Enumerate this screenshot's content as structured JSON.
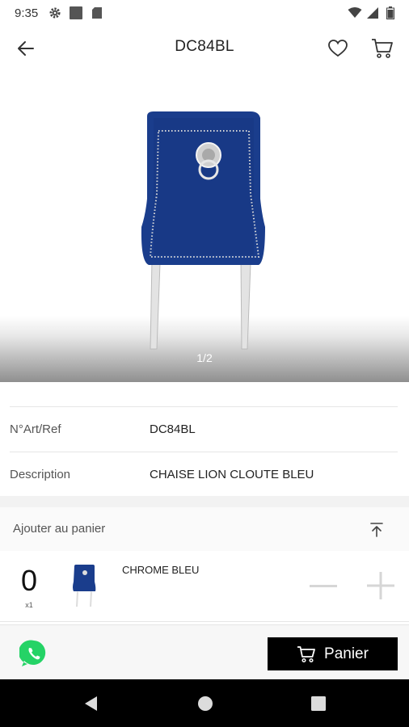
{
  "status_bar": {
    "time": "9:35",
    "left_icons": [
      "gear-icon",
      "square-icon",
      "sd-card-icon"
    ],
    "right_icons": [
      "wifi-icon",
      "signal-icon",
      "battery-icon"
    ]
  },
  "app_bar": {
    "title": "DC84BL",
    "back_icon": "arrow-left-icon",
    "favorite_icon": "heart-outline-icon",
    "cart_icon": "cart-icon"
  },
  "gallery": {
    "counter": "1/2",
    "image": "blue velvet dining chair with lion head knocker and chrome legs"
  },
  "info": {
    "rows": [
      {
        "label": "N°Art/Ref",
        "value": "DC84BL"
      },
      {
        "label": "Description",
        "value": "CHAISE LION CLOUTE BLEU"
      }
    ]
  },
  "cart_section": {
    "header_label": "Ajouter au panier",
    "collapse_icon": "collapse-to-top-icon",
    "variant": {
      "quantity": "0",
      "unit": "x1",
      "name": "CHROME BLEU",
      "minus_icon": "minus-icon",
      "plus_icon": "plus-icon"
    }
  },
  "action_bar": {
    "whatsapp_icon": "whatsapp-icon",
    "panier_label": "Panier",
    "panier_icon": "cart-icon"
  },
  "nav_bar": {
    "buttons": [
      "nav-back-icon",
      "nav-home-icon",
      "nav-recent-icon"
    ]
  },
  "colors": {
    "chair_blue": "#1a3d8c",
    "button_black": "#000000",
    "whatsapp_green": "#25d366",
    "text_dark": "#222222",
    "text_muted": "#555555"
  }
}
